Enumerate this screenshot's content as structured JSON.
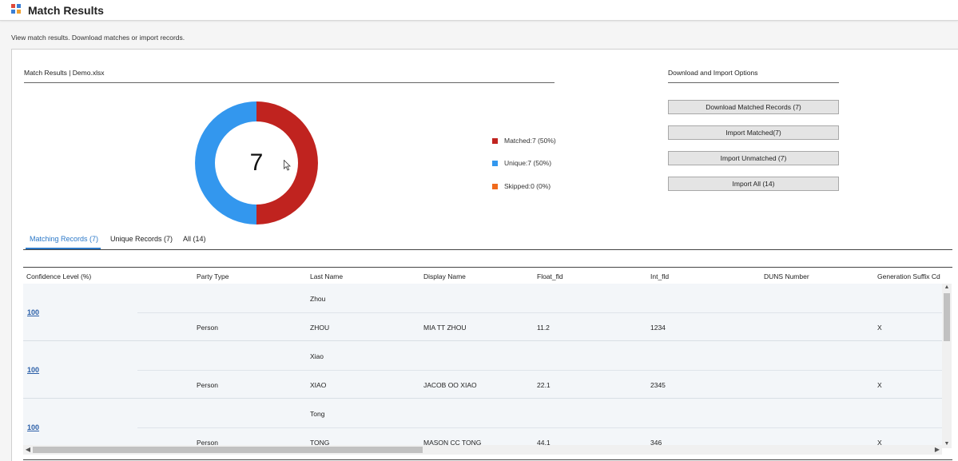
{
  "app": {
    "title": "Match Results",
    "subtitle": "View match results. Download matches or import records."
  },
  "summary": {
    "title": "Match Results | Demo.xlsx",
    "total": "7",
    "legend": [
      {
        "label": "Matched:7 (50%)",
        "color": "#c0231f"
      },
      {
        "label": "Unique:7 (50%)",
        "color": "#3397ee"
      },
      {
        "label": "Skipped:0 (0%)",
        "color": "#f06a1c"
      }
    ]
  },
  "chart_data": {
    "type": "pie",
    "labels": [
      "Matched",
      "Unique",
      "Skipped"
    ],
    "values": [
      7,
      7,
      0
    ],
    "percents": [
      50,
      50,
      0
    ],
    "colors": [
      "#c0231f",
      "#3397ee",
      "#f06a1c"
    ],
    "center_label": "7",
    "donut": true
  },
  "options": {
    "title": "Download and Import Options",
    "buttons": [
      {
        "label": "Download Matched Records (7)"
      },
      {
        "label": "Import Matched(7)"
      },
      {
        "label": "Import Unmatched (7)"
      },
      {
        "label": "Import All (14)"
      }
    ]
  },
  "tabs": [
    {
      "label": "Matching Records (7)",
      "active": true
    },
    {
      "label": "Unique Records (7)",
      "active": false
    },
    {
      "label": "All (14)",
      "active": false
    }
  ],
  "table": {
    "columns": [
      "Confidence Level (%)",
      "Party Type",
      "Last Name",
      "Display Name",
      "Float_fld",
      "Int_fld",
      "DUNS Number",
      "Generation Suffix Cd"
    ],
    "groups": [
      {
        "confidence": "100",
        "rows": [
          [
            "",
            "",
            "Zhou",
            "",
            "",
            "",
            "",
            ""
          ],
          [
            "",
            "Person",
            "ZHOU",
            "MIA TT ZHOU",
            "11.2",
            "1234",
            "",
            "X"
          ]
        ]
      },
      {
        "confidence": "100",
        "rows": [
          [
            "",
            "",
            "Xiao",
            "",
            "",
            "",
            "",
            ""
          ],
          [
            "",
            "Person",
            "XIAO",
            "JACOB OO XIAO",
            "22.1",
            "2345",
            "",
            "X"
          ]
        ]
      },
      {
        "confidence": "100",
        "rows": [
          [
            "",
            "",
            "Tong",
            "",
            "",
            "",
            "",
            ""
          ],
          [
            "",
            "Person",
            "TONG",
            "MASON CC TONG",
            "44.1",
            "346",
            "",
            "X"
          ]
        ]
      }
    ]
  }
}
